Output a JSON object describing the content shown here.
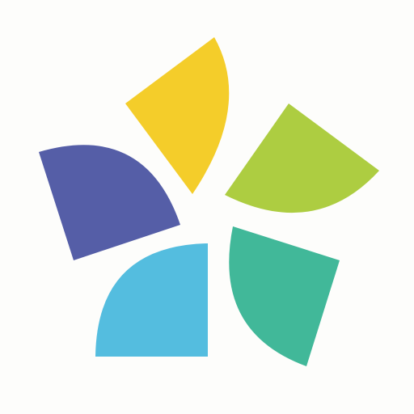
{
  "logo": {
    "icon": "pinwheel-flower-icon",
    "petal_count": 5,
    "background_color": "#fdfdfb",
    "petals": [
      {
        "name": "yellow",
        "color": "#f4cd2a"
      },
      {
        "name": "lime",
        "color": "#adcd41"
      },
      {
        "name": "teal",
        "color": "#41b899"
      },
      {
        "name": "sky-blue",
        "color": "#54bddf"
      },
      {
        "name": "indigo",
        "color": "#555ea7"
      }
    ]
  }
}
